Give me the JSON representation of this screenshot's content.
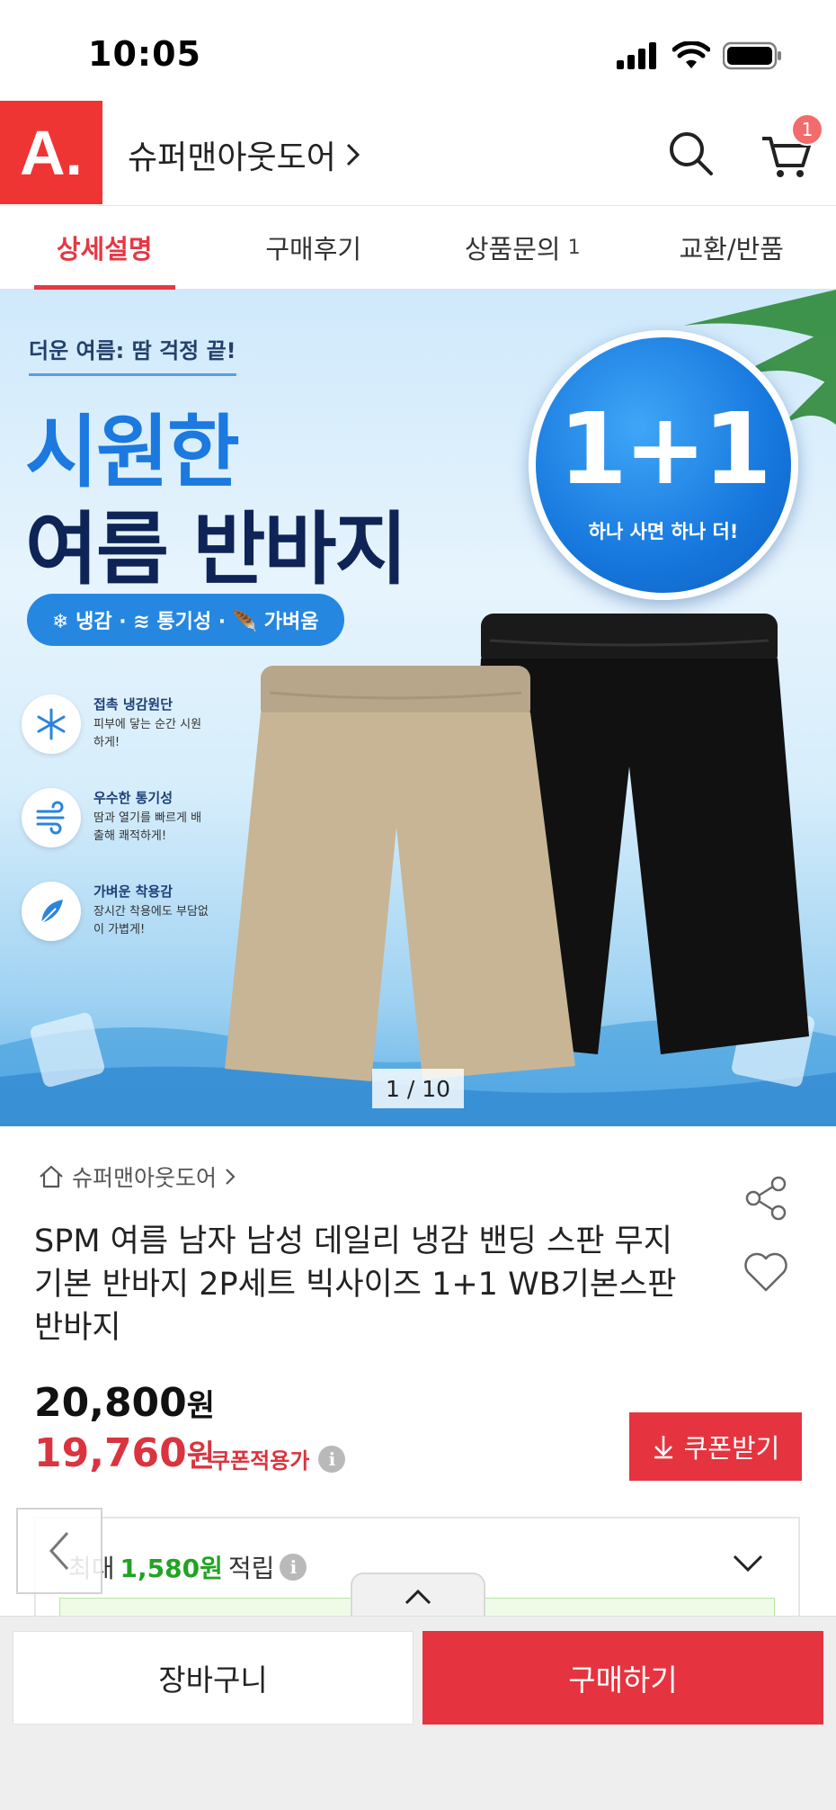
{
  "status_bar": {
    "time": "10:05"
  },
  "header": {
    "logo_text": "A.",
    "store_name": "슈퍼맨아웃도어",
    "cart_count": "1",
    "brand_color": "#ef3434"
  },
  "tabs": [
    {
      "label": "상세설명",
      "count": "",
      "active": true
    },
    {
      "label": "구매후기",
      "count": ""
    },
    {
      "label": "상품문의",
      "count": "1"
    },
    {
      "label": "교환/반품",
      "count": ""
    }
  ],
  "banner": {
    "subtitle": "더운 여름: 땀 걱정 끝!",
    "title_line1": "시원한",
    "title_line2": "여름 반바지",
    "features_pill": "❄ 냉감 · ≋ 통기성 · 🪶 가벼움",
    "badge_big": "1+1",
    "badge_small": "하나 사면 하나 더!",
    "features": [
      {
        "icon": "snowflake-icon",
        "title": "접촉 냉감원단",
        "desc": "피부에 닿는 순간 시원하게!"
      },
      {
        "icon": "wind-icon",
        "title": "우수한 통기성",
        "desc": "땀과 열기를 빠르게 배출해 쾌적하게!"
      },
      {
        "icon": "feather-icon",
        "title": "가벼운 착용감",
        "desc": "장시간 착용에도 부담없이 가볍게!"
      }
    ],
    "slide_counter": "1 / 10"
  },
  "product": {
    "breadcrumb": "슈퍼맨아웃도어",
    "title": "SPM 여름 남자 남성 데일리 냉감 밴딩 스판 무지 기본 반바지 2P세트 빅사이즈 1+1 WB기본스판반바지",
    "price_original": "20,800",
    "price_sale": "19,760",
    "currency": "원",
    "coupon_applied_label": "쿠폰적용가",
    "coupon_button": "쿠폰받기",
    "reward_prefix": "최대",
    "reward_amount": "1,580원",
    "reward_suffix": "적립",
    "accent_color": "#e5343f",
    "reward_color": "#23a324"
  },
  "bottom_bar": {
    "add_to_cart": "장바구니",
    "buy_now": "구매하기"
  }
}
